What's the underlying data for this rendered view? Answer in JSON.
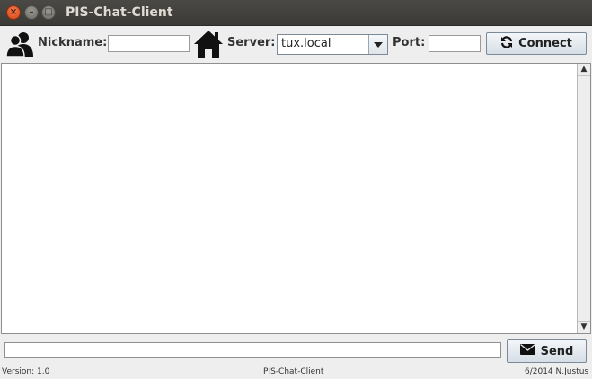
{
  "window": {
    "title": "PIS-Chat-Client",
    "controls": {
      "close": "×",
      "minimize": "–",
      "maximize": "□"
    }
  },
  "toolbar": {
    "nickname_label": "Nickname:",
    "nickname_value": "",
    "server_label": "Server:",
    "server_value": "tux.local",
    "port_label": "Port:",
    "port_value": "",
    "connect_label": "Connect",
    "icons": {
      "nickname": "users-icon",
      "server": "home-icon",
      "connect": "refresh-icon",
      "dropdown": "chevron-down-icon"
    }
  },
  "chat": {
    "messages": [],
    "scroll": {
      "up": "▲",
      "down": "▼"
    }
  },
  "compose": {
    "message_value": "",
    "send_label": "Send",
    "icons": {
      "send": "envelope-icon"
    }
  },
  "statusbar": {
    "version": "Version: 1.0",
    "app_name": "PIS-Chat-Client",
    "credit": "6/2014 N.Justus"
  }
}
